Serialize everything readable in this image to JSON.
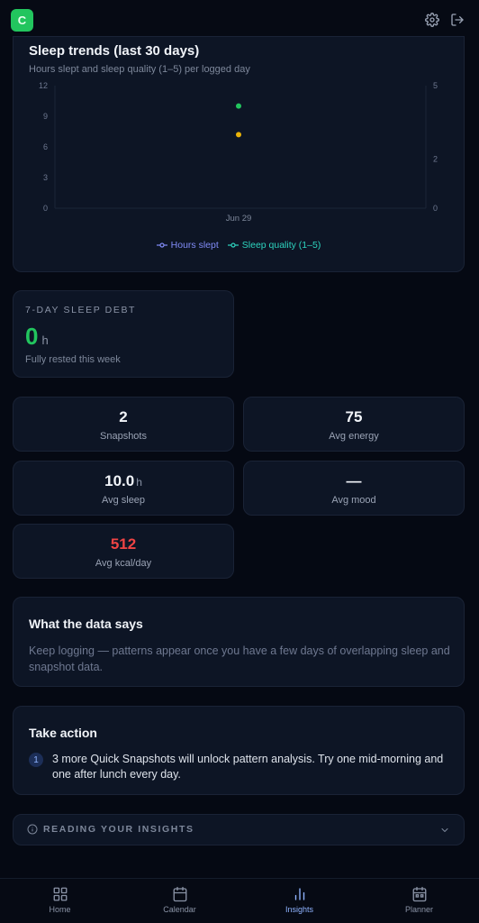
{
  "app": {
    "logo_letter": "C"
  },
  "header": {
    "settings_icon": "gear-icon",
    "logout_icon": "logout-icon"
  },
  "sleep_trends": {
    "title": "Sleep trends (last 30 days)",
    "subtitle": "Hours slept and sleep quality (1–5) per logged day",
    "legend": {
      "hours": "Hours slept",
      "quality": "Sleep quality (1–5)"
    }
  },
  "chart_data": {
    "type": "scatter",
    "title": "Sleep trends (last 30 days)",
    "x": [
      "Jun 29"
    ],
    "left_axis": {
      "ticks": [
        "0",
        "3",
        "6",
        "9",
        "12"
      ],
      "ylim": [
        0,
        12
      ]
    },
    "right_axis": {
      "ticks": [
        "0",
        "2",
        "5"
      ],
      "ylim": [
        0,
        5
      ]
    },
    "series": [
      {
        "name": "Hours slept",
        "axis": "left",
        "values": [
          10
        ],
        "color": "#22c55e"
      },
      {
        "name": "Sleep quality (1–5)",
        "axis": "right",
        "values": [
          3
        ],
        "color": "#eab308"
      }
    ],
    "legend_colors": {
      "hours": "#818cf8",
      "quality": "#2dd4bf"
    },
    "grid": false,
    "legend_position": "bottom"
  },
  "sleep_debt": {
    "label": "7-DAY SLEEP DEBT",
    "value": "0",
    "unit": "h",
    "note": "Fully rested this week",
    "color": "#22c55e"
  },
  "stats": {
    "snapshots": {
      "value": "2",
      "label": "Snapshots"
    },
    "energy": {
      "value": "75",
      "label": "Avg energy"
    },
    "sleep": {
      "value": "10.0",
      "unit": "h",
      "label": "Avg sleep"
    },
    "mood": {
      "value": "—",
      "label": "Avg mood"
    },
    "kcal": {
      "value": "512",
      "label": "Avg kcal/day",
      "color": "#ef4444"
    }
  },
  "insights": {
    "title": "What the data says",
    "body": "Keep logging — patterns appear once you have a few days of overlapping sleep and snapshot data."
  },
  "take_action": {
    "title": "Take action",
    "items": [
      {
        "number": "1",
        "text": "3 more Quick Snapshots will unlock pattern analysis. Try one mid-morning and one after lunch every day."
      }
    ]
  },
  "reading": {
    "label": "READING YOUR INSIGHTS"
  },
  "nav": {
    "items": [
      {
        "label": "Home",
        "icon": "grid-icon"
      },
      {
        "label": "Calendar",
        "icon": "calendar-icon"
      },
      {
        "label": "Insights",
        "icon": "bar-chart-icon",
        "active": true
      },
      {
        "label": "Planner",
        "icon": "planner-icon"
      }
    ],
    "active_color": "#8fb3ff"
  }
}
